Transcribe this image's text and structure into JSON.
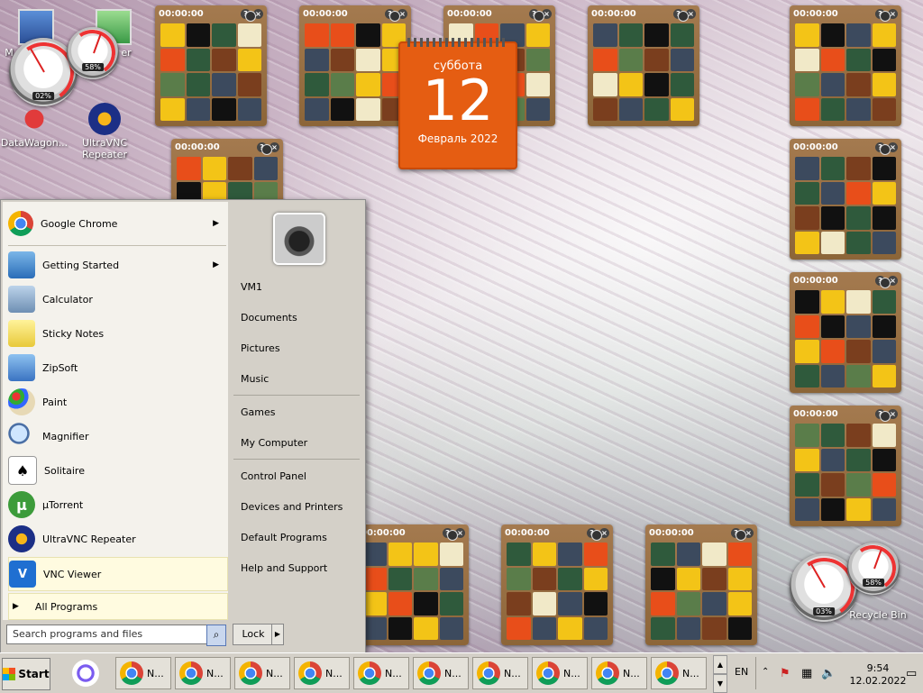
{
  "desktop": {
    "icons": [
      {
        "label": "DataWagon...",
        "icon": "datawagon-icon"
      },
      {
        "label": "UltraVNC Repeater",
        "icon": "ultravnc-icon"
      }
    ],
    "partial_labels": {
      "left": "M",
      "right": "er"
    },
    "gauges": [
      {
        "percent": "02%",
        "icon": "cpu-gauge-icon"
      },
      {
        "percent": "58%",
        "icon": "memory-gauge-icon"
      },
      {
        "percent": "03%",
        "icon": "cpu-gauge-icon"
      },
      {
        "percent": "58%",
        "icon": "memory-gauge-icon"
      }
    ],
    "recycle_bin_label": "Recycle Bin"
  },
  "puzzle_widget": {
    "timer": "00:00:00",
    "help": "?",
    "close": "×"
  },
  "calendar": {
    "day_of_week": "суббота",
    "day": "12",
    "month_year": "Февраль 2022"
  },
  "start_menu": {
    "programs": [
      {
        "label": "Google Chrome",
        "icon": "chrome-icon",
        "submenu": true
      },
      {
        "label": "Getting Started",
        "icon": "getting-started-icon",
        "submenu": true
      },
      {
        "label": "Calculator",
        "icon": "calculator-icon"
      },
      {
        "label": "Sticky Notes",
        "icon": "sticky-notes-icon"
      },
      {
        "label": "ZipSoft",
        "icon": "zipsoft-icon"
      },
      {
        "label": "Paint",
        "icon": "paint-icon"
      },
      {
        "label": "Magnifier",
        "icon": "magnifier-icon"
      },
      {
        "label": "Solitaire",
        "icon": "solitaire-icon"
      },
      {
        "label": "µTorrent",
        "icon": "utorrent-icon"
      },
      {
        "label": "UltraVNC Repeater",
        "icon": "ultravnc-icon"
      },
      {
        "label": "VNC Viewer",
        "icon": "vnc-viewer-icon",
        "highlighted": true
      }
    ],
    "all_programs": "All Programs",
    "search_placeholder": "Search programs and files",
    "right_items": [
      "VM1",
      "Documents",
      "Pictures",
      "Music",
      "Games",
      "My Computer",
      "Control Panel",
      "Devices and Printers",
      "Default Programs",
      "Help and Support"
    ],
    "lock_label": "Lock"
  },
  "taskbar": {
    "start_label": "Start",
    "window_buttons": [
      "N...",
      "N...",
      "N...",
      "N...",
      "N...",
      "N...",
      "N...",
      "N...",
      "N...",
      "N..."
    ],
    "language": "EN",
    "time": "9:54",
    "date": "12.02.2022"
  }
}
